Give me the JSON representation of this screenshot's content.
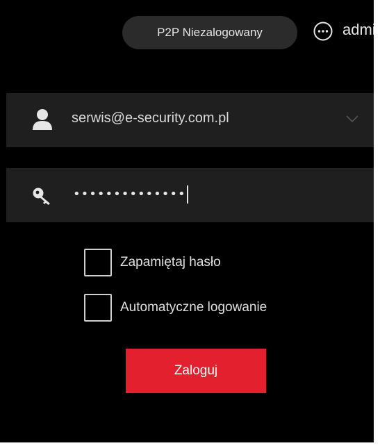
{
  "header": {
    "p2p_status": "P2P Niezalogowany",
    "more_icon": "more-options-icon",
    "user_label": "admin"
  },
  "login": {
    "account": {
      "icon": "user-icon",
      "value": "serwis@e-security.com.pl",
      "dropdown_icon": "chevron-down-icon"
    },
    "password": {
      "icon": "key-icon",
      "masked_value": "••••••••••••••"
    },
    "remember_password": {
      "label": "Zapamiętaj hasło",
      "checked": false
    },
    "auto_login": {
      "label": "Automatyczne logowanie",
      "checked": false
    },
    "submit_label": "Zaloguj"
  },
  "colors": {
    "background": "#000000",
    "field_background": "#1f1f1f",
    "accent": "#e2202e",
    "text": "#e6e6e6"
  }
}
